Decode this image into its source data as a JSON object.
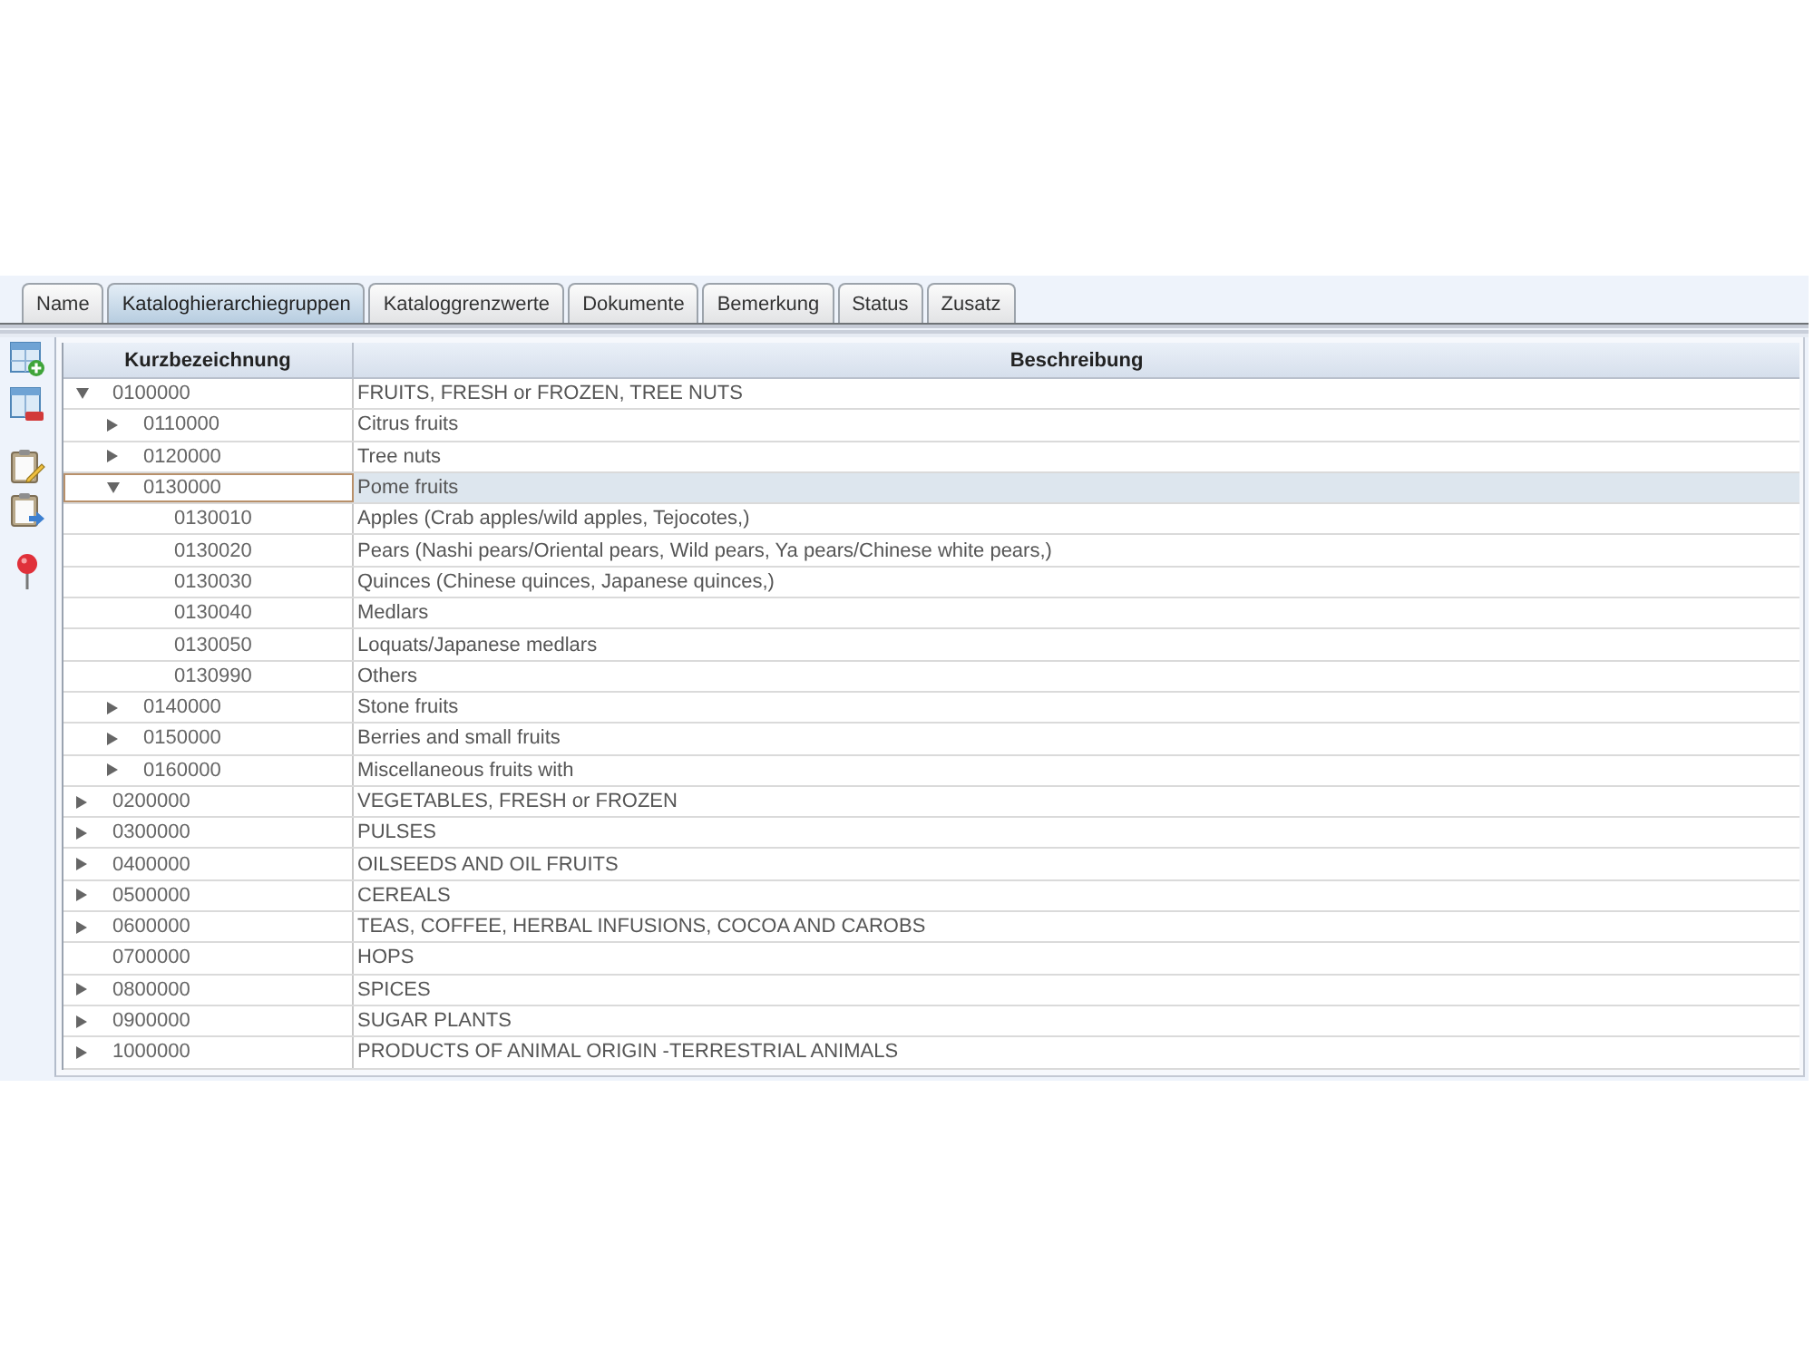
{
  "tabs": [
    {
      "label": "Name",
      "selected": false
    },
    {
      "label": "Kataloghierarchiegruppen",
      "selected": true
    },
    {
      "label": "Kataloggrenzwerte",
      "selected": false
    },
    {
      "label": "Dokumente",
      "selected": false
    },
    {
      "label": "Bemerkung",
      "selected": false
    },
    {
      "label": "Status",
      "selected": false
    },
    {
      "label": "Zusatz",
      "selected": false
    }
  ],
  "table": {
    "columns": [
      "Kurzbezeichnung",
      "Beschreibung"
    ],
    "rows": [
      {
        "code": "0100000",
        "description": "FRUITS, FRESH or FROZEN, TREE NUTS",
        "expanded": true,
        "selected": false,
        "children": [
          {
            "code": "0110000",
            "description": "Citrus fruits",
            "expanded": false,
            "selected": false
          },
          {
            "code": "0120000",
            "description": "Tree nuts",
            "expanded": false,
            "selected": false
          },
          {
            "code": "0130000",
            "description": "Pome fruits",
            "expanded": true,
            "selected": true,
            "children": [
              {
                "code": "0130010",
                "description": "Apples (Crab apples/wild apples, Tejocotes,)",
                "selected": false
              },
              {
                "code": "0130020",
                "description": "Pears (Nashi pears/Oriental pears, Wild pears, Ya pears/Chinese white pears,)",
                "selected": false
              },
              {
                "code": "0130030",
                "description": "Quinces (Chinese quinces, Japanese quinces,)",
                "selected": false
              },
              {
                "code": "0130040",
                "description": "Medlars",
                "selected": false
              },
              {
                "code": "0130050",
                "description": "Loquats/Japanese medlars",
                "selected": false
              },
              {
                "code": "0130990",
                "description": "Others",
                "selected": false
              }
            ]
          },
          {
            "code": "0140000",
            "description": "Stone fruits",
            "expanded": false,
            "selected": false
          },
          {
            "code": "0150000",
            "description": "Berries and small fruits",
            "expanded": false,
            "selected": false
          },
          {
            "code": "0160000",
            "description": "Miscellaneous fruits with",
            "expanded": false,
            "selected": false
          }
        ]
      },
      {
        "code": "0200000",
        "description": "VEGETABLES, FRESH or FROZEN",
        "expanded": false,
        "selected": false
      },
      {
        "code": "0300000",
        "description": "PULSES",
        "expanded": false,
        "selected": false
      },
      {
        "code": "0400000",
        "description": "OILSEEDS AND OIL FRUITS",
        "expanded": false,
        "selected": false
      },
      {
        "code": "0500000",
        "description": "CEREALS",
        "expanded": false,
        "selected": false
      },
      {
        "code": "0600000",
        "description": "TEAS, COFFEE, HERBAL INFUSIONS, COCOA AND CAROBS",
        "expanded": false,
        "selected": false
      },
      {
        "code": "0700000",
        "description": "HOPS",
        "selected": false
      },
      {
        "code": "0800000",
        "description": "SPICES",
        "expanded": false,
        "selected": false
      },
      {
        "code": "0900000",
        "description": "SUGAR PLANTS",
        "expanded": false,
        "selected": false
      },
      {
        "code": "1000000",
        "description": "PRODUCTS OF ANIMAL ORIGIN -TERRESTRIAL ANIMALS",
        "expanded": false,
        "selected": false
      }
    ]
  }
}
